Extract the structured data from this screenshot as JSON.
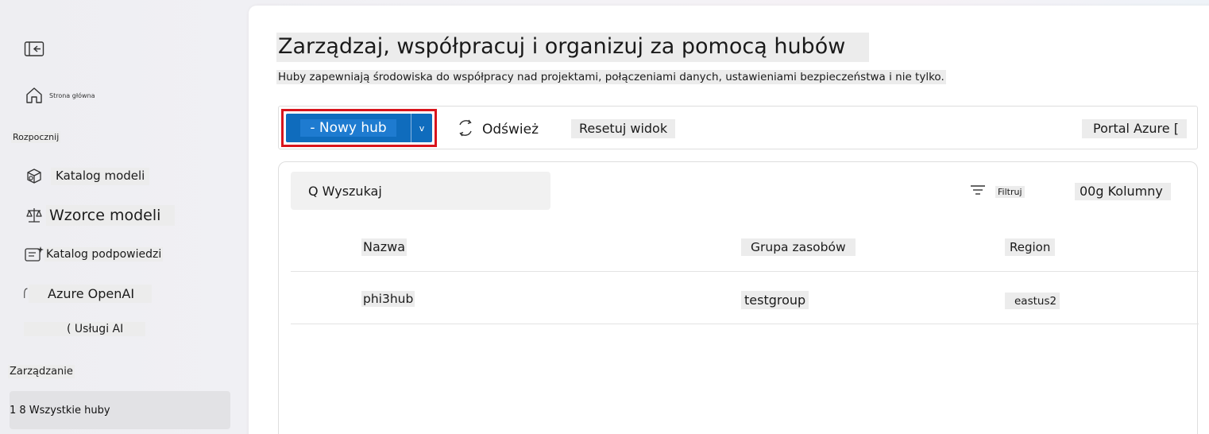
{
  "sidebar": {
    "collapse_icon": "panel-collapse-icon",
    "home": {
      "icon": "home-icon",
      "label": "Strona główna"
    },
    "section_start": "Rozpocznij",
    "items": [
      {
        "icon": "cube-icon",
        "label": "Katalog modeli"
      },
      {
        "icon": "scale-icon",
        "label": "Wzorce modeli"
      },
      {
        "icon": "prompt-catalog-icon",
        "label": "Katalog podpowiedzi"
      },
      {
        "icon": "openai-icon",
        "label": "Azure OpenAI"
      },
      {
        "icon": "ai-services-icon",
        "label": "( Usługi AI"
      }
    ],
    "section_manage": "Zarządzanie",
    "all_hubs": "1 8 Wszystkie huby"
  },
  "main": {
    "title": "Zarządzaj, współpracuj i organizuj za pomocą hubów",
    "subtitle": "Huby zapewniają środowiska do współpracy nad projektami, połączeniami danych, ustawieniami bezpieczeństwa i nie tylko."
  },
  "toolbar": {
    "new_hub_label": "- Nowy hub",
    "new_hub_dropdown": "v",
    "refresh_label": "Odśwież",
    "reset_label": "Resetuj widok",
    "portal_label": "Portal Azure ["
  },
  "table": {
    "search_text": "Q Wyszukaj",
    "filter_label": "Filtruj",
    "columns_label": "00g Kolumny",
    "headers": [
      "Nazwa",
      "Grupa zasobów",
      "Region"
    ],
    "rows": [
      {
        "name": "phi3hub",
        "group": "testgroup",
        "region": "eastus2"
      }
    ]
  },
  "colors": {
    "accent": "#0f6cbd",
    "highlight_border": "#d9141c",
    "selected_nav_bg": "#e2e2e5"
  }
}
